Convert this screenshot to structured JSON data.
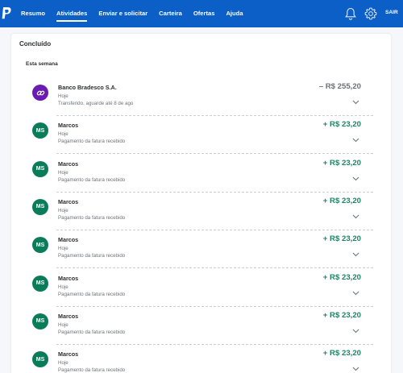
{
  "colors": {
    "header_bg": "#0b5fc6",
    "positive": "#1f8461",
    "negative": "#6c7378",
    "avatar_green": "#0b7c5a",
    "avatar_purple": "#6b1bb1"
  },
  "header": {
    "nav": [
      "Resumo",
      "Atividades",
      "Enviar e solicitar",
      "Carteira",
      "Ofertas",
      "Ajuda"
    ],
    "active": "Atividades",
    "logout": "SAIR"
  },
  "main": {
    "section_title": "Concluído",
    "week_title": "Esta semana",
    "transactions": [
      {
        "avatar": "link-icon",
        "avatar_color": "#6b1bb1",
        "name": "Banco Bradesco S.A.",
        "date": "Hoje",
        "detail": "Transferido, aguarde até 8 de ago",
        "amount": "– R$ 255,20",
        "sign": "negative"
      },
      {
        "avatar": "MS",
        "avatar_color": "#0b7c5a",
        "name": "Marcos",
        "date": "Hoje",
        "detail": "Pagamento da fatura recebido",
        "amount": "+ R$ 23,20",
        "sign": "positive"
      },
      {
        "avatar": "MS",
        "avatar_color": "#0b7c5a",
        "name": "Marcos",
        "date": "Hoje",
        "detail": "Pagamento da fatura recebido",
        "amount": "+ R$ 23,20",
        "sign": "positive"
      },
      {
        "avatar": "MS",
        "avatar_color": "#0b7c5a",
        "name": "Marcos",
        "date": "Hoje",
        "detail": "Pagamento da fatura recebido",
        "amount": "+ R$ 23,20",
        "sign": "positive"
      },
      {
        "avatar": "MS",
        "avatar_color": "#0b7c5a",
        "name": "Marcos",
        "date": "Hoje",
        "detail": "Pagamento da fatura recebido",
        "amount": "+ R$ 23,20",
        "sign": "positive"
      },
      {
        "avatar": "MS",
        "avatar_color": "#0b7c5a",
        "name": "Marcos",
        "date": "Hoje",
        "detail": "Pagamento da fatura recebido",
        "amount": "+ R$ 23,20",
        "sign": "positive"
      },
      {
        "avatar": "MS",
        "avatar_color": "#0b7c5a",
        "name": "Marcos",
        "date": "Hoje",
        "detail": "Pagamento da fatura recebido",
        "amount": "+ R$ 23,20",
        "sign": "positive"
      },
      {
        "avatar": "MS",
        "avatar_color": "#0b7c5a",
        "name": "Marcos",
        "date": "Hoje",
        "detail": "Pagamento da fatura recebido",
        "amount": "+ R$ 23,20",
        "sign": "positive"
      }
    ]
  }
}
